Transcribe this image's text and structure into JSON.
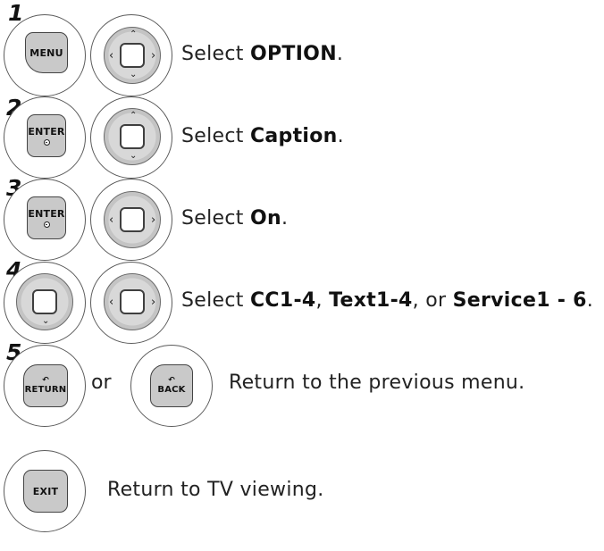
{
  "steps": [
    {
      "number": "1",
      "prefix": "Select ",
      "bold": "OPTION",
      "suffix": "."
    },
    {
      "number": "2",
      "prefix": "Select ",
      "bold": "Caption",
      "suffix": "."
    },
    {
      "number": "3",
      "prefix": "Select ",
      "bold": "On",
      "suffix": "."
    },
    {
      "number": "4",
      "prefix": "Select ",
      "bold1": "CC1-4",
      "sep1": ", ",
      "bold2": "Text1-4",
      "sep2": ", or ",
      "bold3": "Service1 - 6",
      "suffix": "."
    },
    {
      "number": "5",
      "connector": "or",
      "text": "Return to the previous menu."
    },
    {
      "text": "Return to TV viewing."
    }
  ],
  "keys": {
    "menu": "MENU",
    "enter": "ENTER",
    "return": "RETURN",
    "back": "BACK",
    "exit": "EXIT"
  },
  "icons": {
    "up": "⌃",
    "down": "⌄",
    "left": "‹",
    "right": "›",
    "return_glyph": "↶"
  }
}
